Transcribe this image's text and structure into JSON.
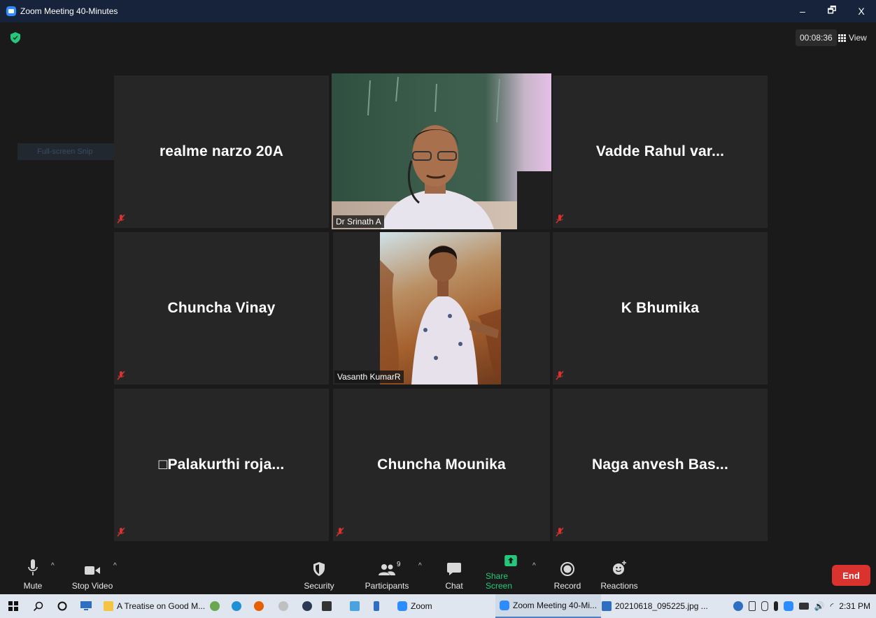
{
  "window": {
    "title": "Zoom Meeting 40-Minutes",
    "controls": {
      "minimize": "–",
      "restore": "🗗",
      "close": "X"
    }
  },
  "header": {
    "timer": "00:08:36",
    "view_label": "View",
    "snip_label": "Full-screen Snip"
  },
  "tiles": [
    {
      "name": "realme narzo 20A",
      "muted": true
    },
    {
      "name": "Dr Srinath A",
      "video": true,
      "active_speaker": true
    },
    {
      "name": "Vadde Rahul var...",
      "muted": true
    },
    {
      "name": "Chuncha Vinay",
      "muted": true
    },
    {
      "name": "Vasanth KumarR",
      "video": true
    },
    {
      "name": "K Bhumika",
      "muted": true
    },
    {
      "name": "□Palakurthi  roja...",
      "muted": true
    },
    {
      "name": "Chuncha Mounika",
      "muted": true
    },
    {
      "name": "Naga anvesh Bas...",
      "muted": true
    }
  ],
  "toolbar": {
    "mute": "Mute",
    "stop_video": "Stop Video",
    "security": "Security",
    "participants": "Participants",
    "participants_count": "9",
    "chat": "Chat",
    "share_screen": "Share Screen",
    "record": "Record",
    "reactions": "Reactions",
    "end": "End",
    "caret": "^"
  },
  "taskbar": {
    "apps": [
      "A Treatise on Good M...",
      "Zoom",
      "Zoom Meeting 40-Mi...",
      "20210618_095225.jpg ..."
    ],
    "clock": "2:31 PM"
  },
  "colors": {
    "titlebar": "#17233a",
    "background": "#1a1a1a",
    "tile": "#262626",
    "active_border": "#d8e86a",
    "share_green": "#25c87a",
    "end_red": "#d9322f",
    "mute_red": "#d9322f",
    "taskbar": "#dfe6ef"
  }
}
